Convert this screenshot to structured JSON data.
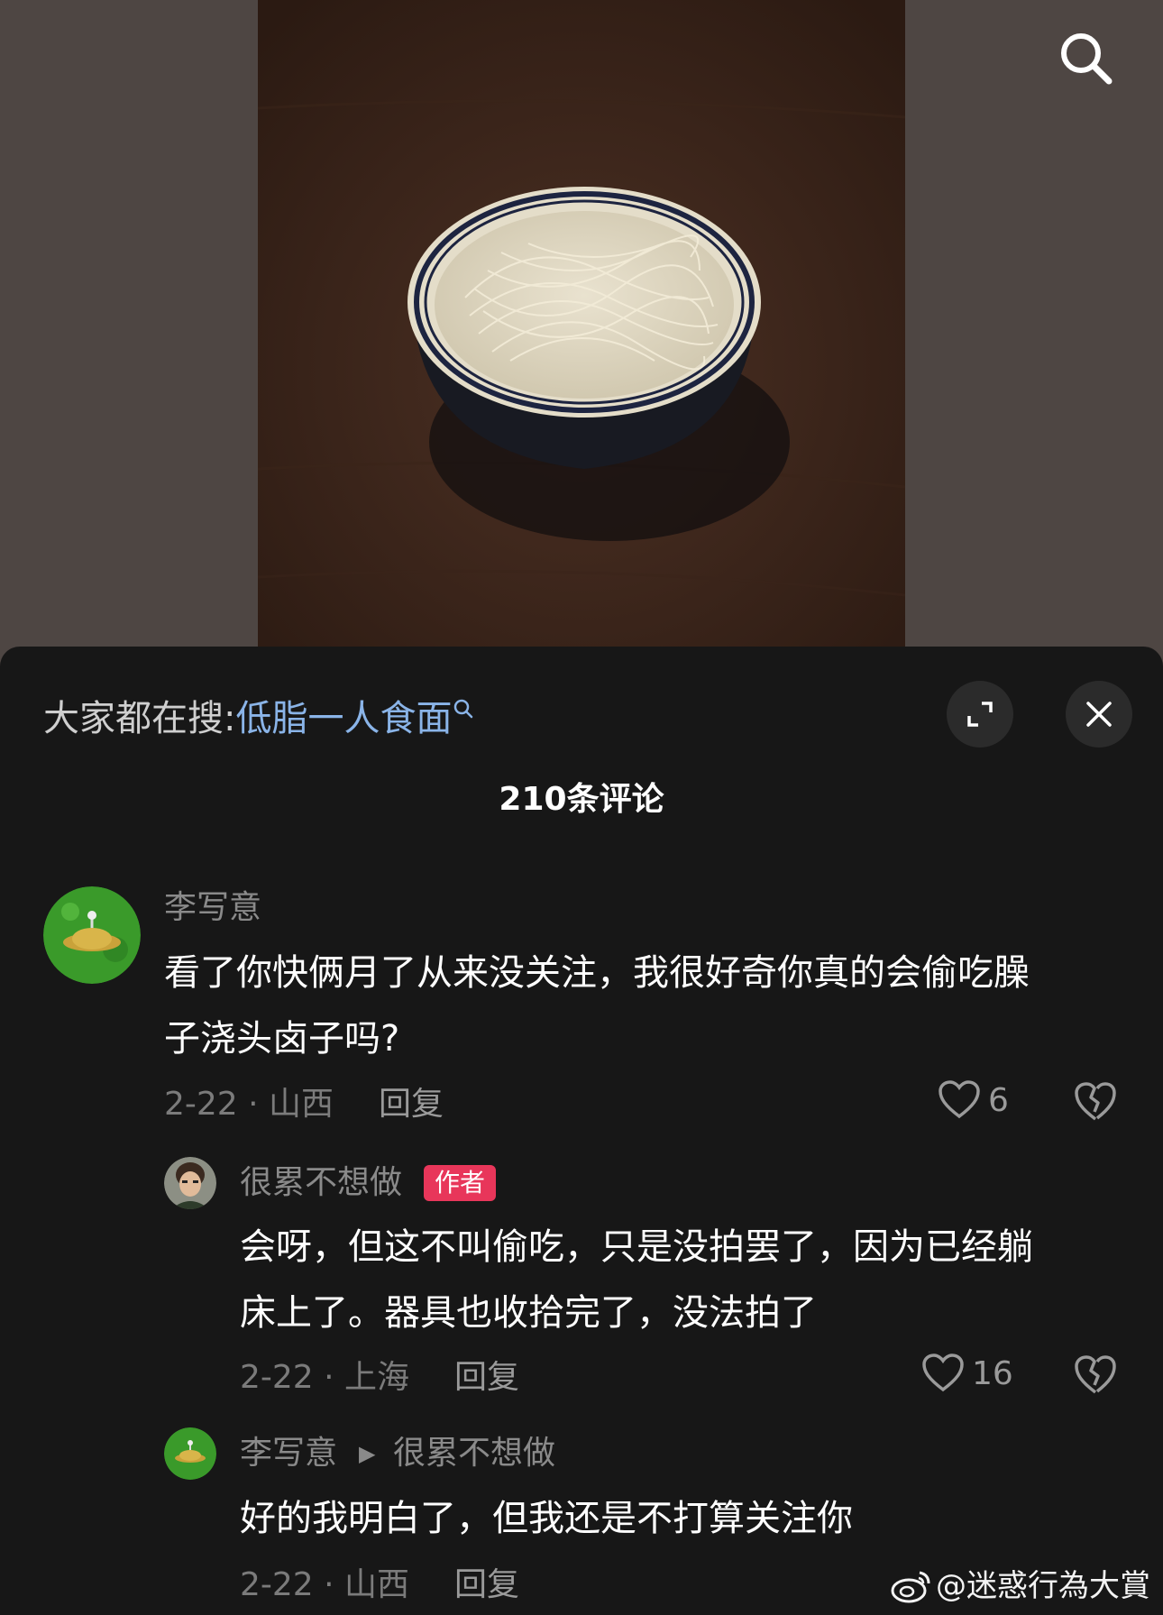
{
  "video": {
    "search_icon": "search-icon"
  },
  "comments_panel": {
    "search_prefix": "大家都在搜:",
    "search_term": "低脂一人食面",
    "comment_count": "210条评论",
    "expand_icon": "expand-icon",
    "close_icon": "close-icon"
  },
  "comments": [
    {
      "username": "李写意",
      "text_line1": "看了你快俩月了从来没关注，我很好奇你真的会偷吃臊",
      "text_line2": "子浇头卤子吗?",
      "date_location": "2-22 · 山西",
      "reply_label": "回复",
      "likes": "6"
    },
    {
      "username": "很累不想做",
      "author_tag": "作者",
      "text_line1": "会呀，但这不叫偷吃，只是没拍罢了，因为已经躺",
      "text_line2": "床上了。器具也收拾完了，没法拍了",
      "date_location": "2-22 · 上海",
      "reply_label": "回复",
      "likes": "16"
    },
    {
      "username": "李写意",
      "reply_to": "很累不想做",
      "text_line1": "好的我明白了，但我还是不打算关注你",
      "date_location": "2-22 · 山西",
      "reply_label": "回复"
    }
  ],
  "watermark": "@迷惑行為大賞",
  "colors": {
    "background": "#171717",
    "search_term": "#8ab4e8",
    "author_tag": "#e8365a"
  }
}
